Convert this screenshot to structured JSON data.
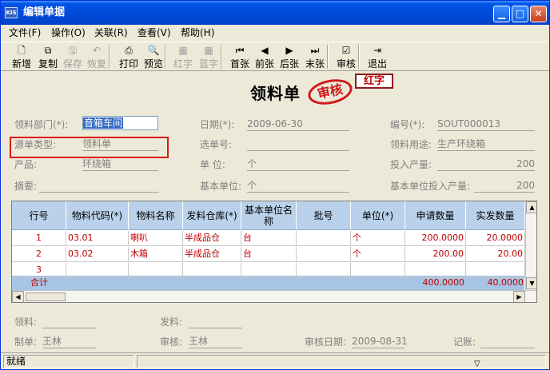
{
  "window": {
    "title": "编辑单据",
    "app_badge": "KIS"
  },
  "menu": [
    "文件(F)",
    "操作(O)",
    "关联(R)",
    "查看(V)",
    "帮助(H)"
  ],
  "toolbar": [
    {
      "label": "新增",
      "icon": "new-doc-icon",
      "glyph": "🗋",
      "enabled": true
    },
    {
      "label": "复制",
      "icon": "copy-icon",
      "glyph": "⧉",
      "enabled": true
    },
    {
      "label": "保存",
      "icon": "save-icon",
      "glyph": "🖫",
      "enabled": false
    },
    {
      "label": "恢复",
      "icon": "undo-icon",
      "glyph": "↶",
      "enabled": false
    },
    {
      "label": "打印",
      "icon": "print-icon",
      "glyph": "⎙",
      "enabled": true
    },
    {
      "label": "预览",
      "icon": "preview-icon",
      "glyph": "🔍",
      "enabled": true
    },
    {
      "label": "红字",
      "icon": "red-word-icon",
      "glyph": "▦",
      "enabled": false
    },
    {
      "label": "蓝字",
      "icon": "blue-word-icon",
      "glyph": "▦",
      "enabled": false
    },
    {
      "label": "首张",
      "icon": "first-icon",
      "glyph": "⏮",
      "enabled": true
    },
    {
      "label": "前张",
      "icon": "prev-icon",
      "glyph": "◀",
      "enabled": true
    },
    {
      "label": "后张",
      "icon": "next-icon",
      "glyph": "▶",
      "enabled": true
    },
    {
      "label": "末张",
      "icon": "last-icon",
      "glyph": "⏭",
      "enabled": true
    },
    {
      "label": "审核",
      "icon": "audit-icon",
      "glyph": "☑",
      "enabled": true
    },
    {
      "label": "退出",
      "icon": "exit-icon",
      "glyph": "⇥",
      "enabled": true
    }
  ],
  "doc": {
    "title": "领料单",
    "seal_text": "审核",
    "red_stamp": "红字"
  },
  "header": {
    "dept_label": "领料部门(*):",
    "dept_value": "音箱车间",
    "source_type_label": "源单类型:",
    "source_type_value": "领料单",
    "product_label": "产品:",
    "product_value": "环绕箱",
    "summary_label": "摘要:",
    "summary_value": "",
    "date_label": "日期(*):",
    "date_value": "2009-06-30",
    "select_label": "选单号:",
    "select_value": "",
    "unit_label": "单  位:",
    "unit_value": "个",
    "base_unit_label": "基本单位:",
    "base_unit_value": "个",
    "number_label": "编号(*):",
    "number_value": "SOUT000013",
    "usage_label": "领料用途:",
    "usage_value": "生产环绕箱",
    "input_qty_label": "投入产量:",
    "input_qty_value": "200",
    "base_input_label": "基本单位投入产量:",
    "base_input_value": "200"
  },
  "grid": {
    "columns": [
      "行号",
      "物料代码(*)",
      "物料名称",
      "发料仓库(*)",
      "基本单位名称",
      "批号",
      "单位(*)",
      "申请数量",
      "实发数量"
    ],
    "rows": [
      {
        "idx": "1",
        "code": "03.01",
        "name": "喇叭",
        "warehouse": "半成品仓",
        "base_unit": "台",
        "batch": "",
        "unit": "个",
        "req": "200.0000",
        "actual": "20.0000"
      },
      {
        "idx": "2",
        "code": "03.02",
        "name": "木箱",
        "warehouse": "半成品仓",
        "base_unit": "台",
        "batch": "",
        "unit": "个",
        "req": "200.00",
        "actual": "20.00"
      },
      {
        "idx": "3",
        "code": "",
        "name": "",
        "warehouse": "",
        "base_unit": "",
        "batch": "",
        "unit": "",
        "req": "",
        "actual": ""
      }
    ],
    "total": {
      "label": "合计",
      "req": "400.0000",
      "actual": "40.0000"
    }
  },
  "footer": {
    "receiver_label": "领料:",
    "receiver_value": "",
    "issuer_label": "发料:",
    "issuer_value": "",
    "maker_label": "制单:",
    "maker_value": "王林",
    "auditor_label": "审核:",
    "auditor_value": "王林",
    "audit_date_label": "审核日期:",
    "audit_date_value": "2009-08-31",
    "bookkeeper_label": "记账:",
    "bookkeeper_value": ""
  },
  "status": {
    "text": "就绪"
  },
  "colors": {
    "title_bar": "#0055e5",
    "grid_header": "#b9d1ea",
    "total_row": "#a6c4e4",
    "red_text": "#c00000",
    "highlight_box": "#d81b1b"
  }
}
